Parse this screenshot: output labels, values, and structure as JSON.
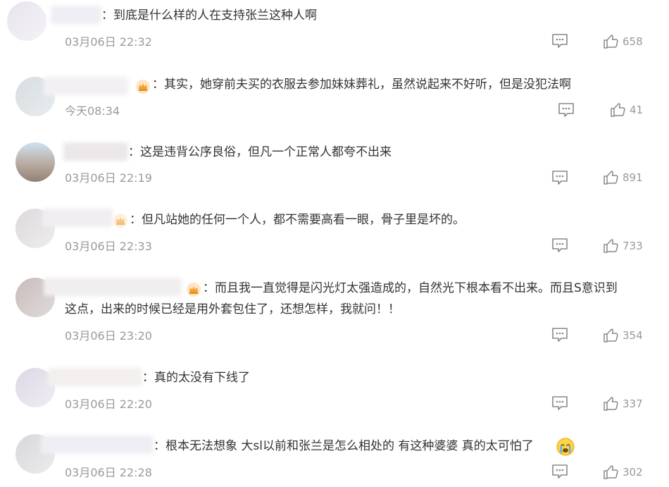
{
  "comments": [
    {
      "text": "到底是什么样的人在支持张兰这种人啊",
      "time": "03月06日 22:32",
      "likes": "658"
    },
    {
      "text": "其实，她穿前夫买的衣服去参加妹妹葬礼，虽然说起来不好听，但是没犯法啊",
      "time": "今天08:34",
      "likes": "41"
    },
    {
      "text": "这是违背公序良俗，但凡一个正常人都夸不出来",
      "time": "03月06日 22:19",
      "likes": "891"
    },
    {
      "text": "但凡站她的任何一个人，都不需要高看一眼，骨子里是坏的。",
      "time": "03月06日 22:33",
      "likes": "733"
    },
    {
      "text_line1": "而且我一直觉得是闪光灯太强造成的，自然光下根本看不出来。而且S意识到",
      "text_line2": "这点，出来的时候已经是用外套包住了，还想怎样，我就问！！",
      "time": "03月06日 23:20",
      "likes": "354"
    },
    {
      "text": "真的太没有下线了",
      "time": "03月06日 22:20",
      "likes": "337"
    },
    {
      "text": "根本无法想象 大sl以前和张兰是怎么相处的 有这种婆婆 真的太可怕了",
      "time": "03月06日 22:28",
      "likes": "302"
    }
  ]
}
